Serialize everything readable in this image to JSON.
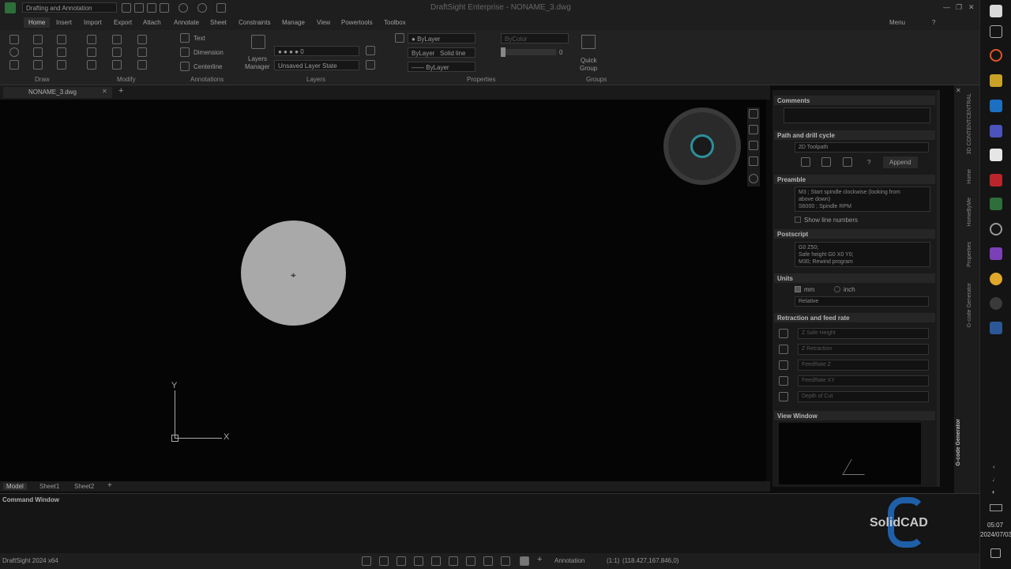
{
  "title_bar": {
    "workspace": "Drafting and Annotation",
    "window_title": "DraftSight Enterprise - NONAME_3.dwg"
  },
  "ribbon_tabs": [
    "Home",
    "Insert",
    "Import",
    "Export",
    "Attach",
    "Annotate",
    "Sheet",
    "Constraints",
    "Manage",
    "View",
    "Powertools",
    "Toolbox"
  ],
  "menu_label": "Menu",
  "ribbon": {
    "groups": [
      "Draw",
      "Modify",
      "Annotations",
      "Layers",
      "Properties",
      "Groups"
    ],
    "annotations": {
      "text": "Text",
      "dimension": "Dimension",
      "centerline": "Centerline"
    },
    "layers": {
      "manager_line1": "Layers",
      "manager_line2": "Manager",
      "current_layer": "0",
      "layer_state": "Unsaved Layer State"
    },
    "properties": {
      "color": "ByLayer",
      "linestyle_bylayer": "ByLayer",
      "linestyle": "Solid line",
      "lineweight": "ByLayer",
      "bycolor": "ByColor",
      "transparency": "0"
    },
    "groups_btn": {
      "line1": "Quick",
      "line2": "Group"
    }
  },
  "doc_tab": "NONAME_3.dwg",
  "sheet_tabs": [
    "Model",
    "Sheet1",
    "Sheet2"
  ],
  "axes": {
    "x": "X",
    "y": "Y"
  },
  "panel": {
    "comments": {
      "title": "Comments"
    },
    "path": {
      "title": "Path and drill cycle",
      "toolpath": "2D Toolpath",
      "help": "?",
      "append": "Append"
    },
    "preamble": {
      "title": "Preamble",
      "line1": "M3     ; Start spindle clockwise (looking from",
      "line2": "above down)",
      "line3": "S6000   ; Spindle RPM",
      "show_line_numbers": "Show line numbers"
    },
    "postscript": {
      "title": "Postscript",
      "line1": "G0 Z50;",
      "line2": "Safe height G0 X0 Y0;",
      "line3": "M30; Rewind program"
    },
    "units": {
      "title": "Units",
      "mm": "mm",
      "inch": "inch",
      "mode": "Relative"
    },
    "retraction": {
      "title": "Retraction and feed rate",
      "fields": [
        "Z Safe Height",
        "Z Retraction",
        "FeedRate Z",
        "FeedRate XY",
        "Depth of Cut"
      ]
    },
    "view_window": {
      "title": "View Window"
    }
  },
  "side_tabs": [
    "3D CONTENTCENTRAL",
    "Home",
    "HomeByMe",
    "Properties",
    "G-code Generator"
  ],
  "side_active_tab": "G-code Generator",
  "command_window": {
    "title": "Command Window"
  },
  "brand": "SolidCAD",
  "status": {
    "app": "DraftSight 2024 x64",
    "annotation": "Annotation",
    "scale": "(1:1)",
    "coords": "(118.427,167.846,0)"
  },
  "clock": {
    "time": "05:07",
    "date": "2024/07/03"
  },
  "colors": {
    "accent": "#1f5fa8",
    "canvas": "#050505",
    "circle": "#a9a9a9",
    "panel": "#1a1a1a"
  }
}
